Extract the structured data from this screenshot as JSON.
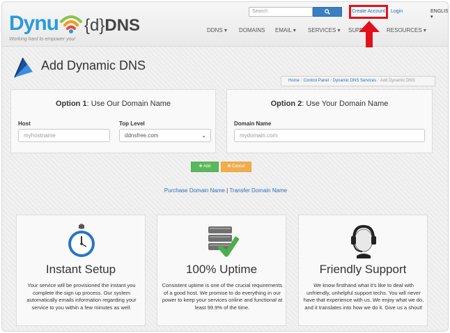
{
  "header": {
    "logo_dynu": "Dynu",
    "logo_dns_brace": "{d}",
    "logo_dns_bold": "DNS",
    "tagline": "Working hard to empower you!",
    "search_placeholder": "Search",
    "create_account": "Create Account",
    "login": "Login",
    "language": "ENGLISH ▾",
    "nav": [
      "DDNS ▾",
      "DOMAINS",
      "EMAIL ▾",
      "SERVICES ▾",
      "SUPPO",
      "RESOURCES ▾"
    ]
  },
  "page": {
    "title": "Add Dynamic DNS",
    "breadcrumb": [
      "Home",
      "Control Panel",
      "Dynamic DNS Services",
      "Add Dynamic DNS"
    ]
  },
  "option1": {
    "title_bold": "Option 1",
    "title_rest": ": Use Our Domain Name",
    "host_label": "Host",
    "host_placeholder": "myhostname",
    "toplevel_label": "Top Level",
    "toplevel_value": "ddnsfree.com"
  },
  "option2": {
    "title_bold": "Option 2",
    "title_rest": ": Use Your Domain Name",
    "domain_label": "Domain Name",
    "domain_placeholder": "mydomain.com"
  },
  "actions": {
    "add": "✚ Add",
    "cancel": "✖ Cancel"
  },
  "links": {
    "purchase": "Purchase Domain Name",
    "separator": " | ",
    "transfer": "Transfer Domain Name"
  },
  "features": [
    {
      "title": "Instant Setup",
      "text": "Your service will be provisioned the instant you complete the sign up process. Our system automatically emails information regarding your service to you within a few minutes as well."
    },
    {
      "title": "100% Uptime",
      "text": "Consistent uptime is one of the crucial requirements of a good host. We promise to do everything in our power to keep your services online and functional at least 99.9% of the time."
    },
    {
      "title": "Friendly Support",
      "text": "We know firsthand what it's like to deal with unfriendly, unhelpful support techs. You will never have that experience with us. We enjoy what we do, and it translates into how we do it. Give us a shout!"
    }
  ],
  "colors": {
    "brand_blue": "#2b9bd8",
    "link_blue": "#2a6ebb",
    "highlight_red": "#e0111b",
    "add_green": "#5cb85c",
    "cancel_orange": "#f0ad4e"
  }
}
